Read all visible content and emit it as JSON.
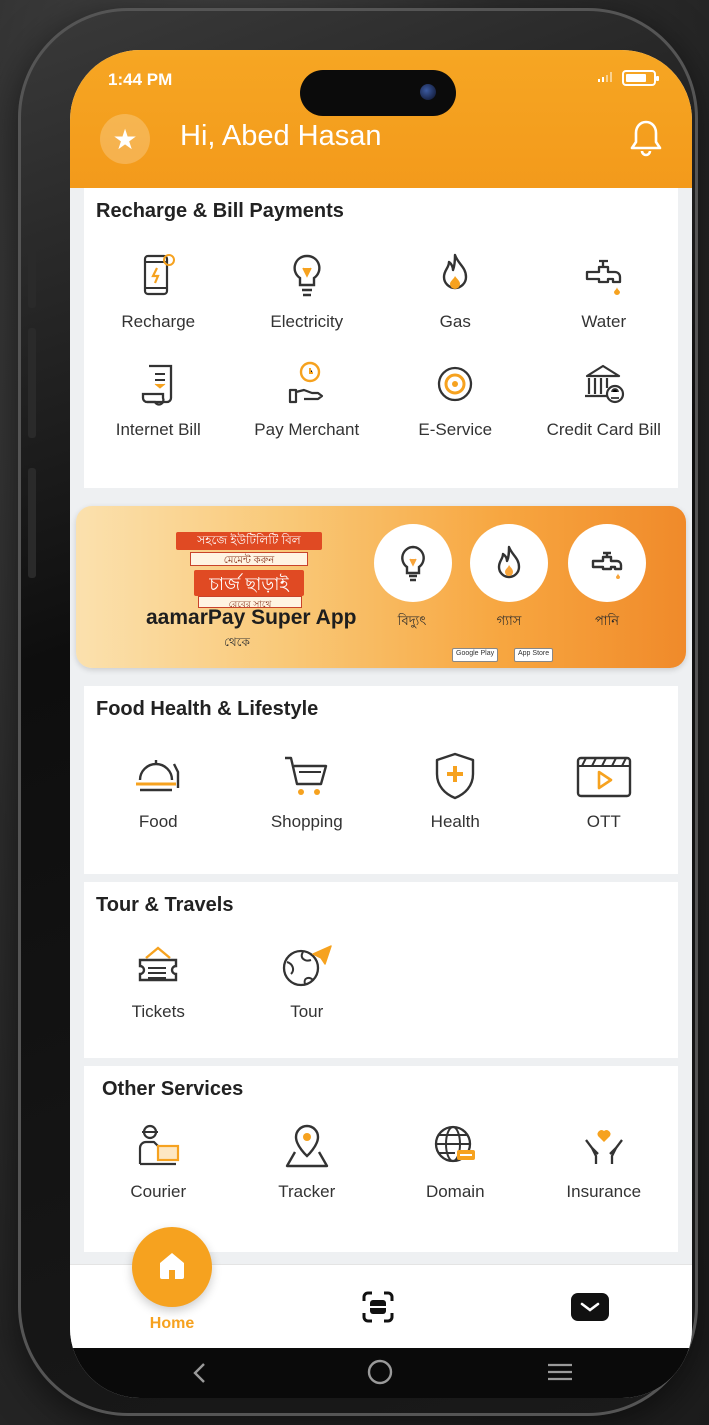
{
  "status": {
    "time": "1:44 PM",
    "battery_level": 0.75
  },
  "header": {
    "greeting": "Hi, Abed Hasan"
  },
  "recharge": {
    "title": "Recharge & Bill Payments",
    "items": [
      {
        "label": "Recharge",
        "icon": "mobile-recharge-icon"
      },
      {
        "label": "Electricity",
        "icon": "bulb-icon"
      },
      {
        "label": "Gas",
        "icon": "flame-icon"
      },
      {
        "label": "Water",
        "icon": "water-tap-icon"
      },
      {
        "label": "Internet Bill",
        "icon": "receipt-icon"
      },
      {
        "label": "Pay Merchant",
        "icon": "hand-coin-icon"
      },
      {
        "label": "E-Service",
        "icon": "target-icon"
      },
      {
        "label": "Credit Card Bill",
        "icon": "bank-icon"
      }
    ]
  },
  "banner": {
    "tag1": "সহজে ইউটিলিটি বিল",
    "tag1b": "মেমেন্ট করুন",
    "tag2": "চার্জ ছাড়াই",
    "tag2b": "রেবের সাথে",
    "app": "aamarPay Super App",
    "from": "থেকে",
    "labels": [
      "বিদ্যুৎ",
      "গ্যাস",
      "পানি"
    ],
    "google_play": "Google Play",
    "app_store": "App Store"
  },
  "food": {
    "title": "Food Health & Lifestyle",
    "items": [
      {
        "label": "Food",
        "icon": "food-cloche-icon"
      },
      {
        "label": "Shopping",
        "icon": "cart-icon"
      },
      {
        "label": "Health",
        "icon": "shield-plus-icon"
      },
      {
        "label": "OTT",
        "icon": "video-play-icon"
      }
    ]
  },
  "travel": {
    "title": "Tour & Travels",
    "items": [
      {
        "label": "Tickets",
        "icon": "ticket-icon"
      },
      {
        "label": "Tour",
        "icon": "globe-plane-icon"
      }
    ]
  },
  "other": {
    "title": "Other Services",
    "items": [
      {
        "label": "Courier",
        "icon": "courier-icon"
      },
      {
        "label": "Tracker",
        "icon": "map-pin-icon"
      },
      {
        "label": "Domain",
        "icon": "globe-icon"
      },
      {
        "label": "Insurance",
        "icon": "hands-heart-icon"
      }
    ]
  },
  "nav": {
    "home": "Home"
  },
  "colors": {
    "accent": "#f6a21f",
    "icon_stroke": "#333333",
    "banner_red": "#e04a23"
  }
}
